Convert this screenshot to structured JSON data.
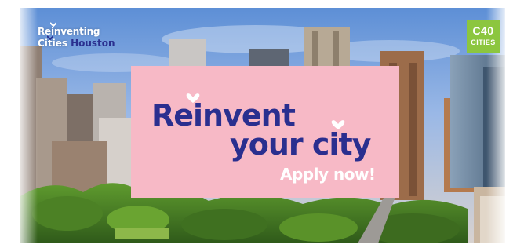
{
  "banner": {
    "logo": {
      "line1": "Reinventing",
      "line2_prefix": "Cities",
      "line2_city": "Houston"
    },
    "badge": {
      "top": "C40",
      "bottom": "CITIES",
      "color": "#8cc63f"
    },
    "card": {
      "headline_line1": "Reinvent",
      "headline_line2": "your city",
      "cta": "Apply now!",
      "background": "#f7b9c6",
      "text_color": "#2a2f8f"
    }
  }
}
